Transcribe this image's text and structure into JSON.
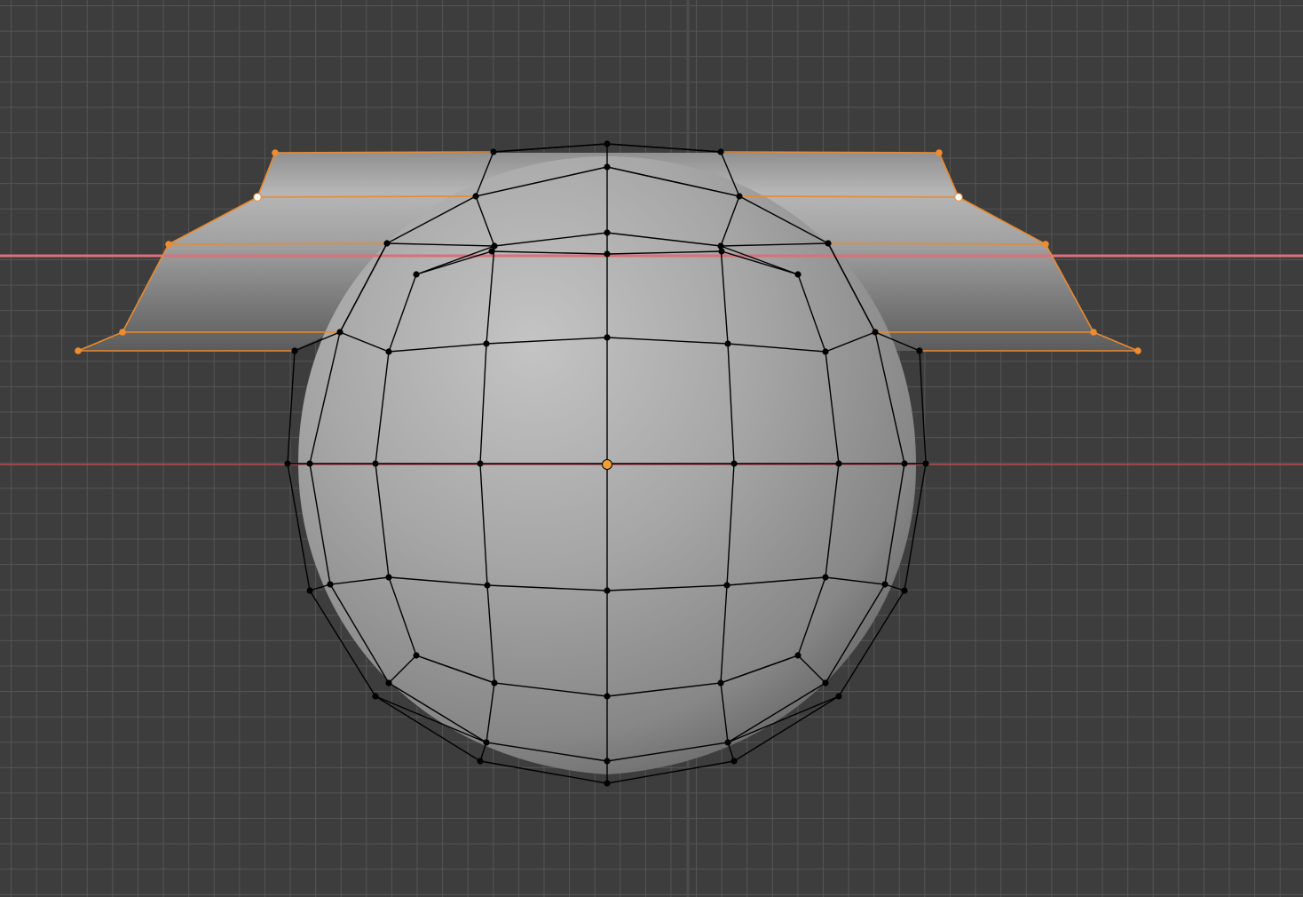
{
  "viewport": {
    "background": "#3d3d3d",
    "grid_color": "#565656",
    "x_axis_color": "#d9707a",
    "red_axis_color": "#b84a55"
  },
  "colors": {
    "mesh_surface_light": "#bdbdbd",
    "mesh_surface_mid": "#9a9a9a",
    "mesh_surface_dark": "#6f6f6f",
    "wire": "#000000",
    "vertex": "#000000",
    "selected_edge": "#e98a2e",
    "selected_vertex": "#f08c30",
    "active_vertex": "#ffffff",
    "origin": "#f0a030"
  },
  "objects": [
    {
      "name": "sphere",
      "mode": "edit"
    },
    {
      "name": "wing_strip",
      "mode": "edit",
      "selected": true
    }
  ]
}
